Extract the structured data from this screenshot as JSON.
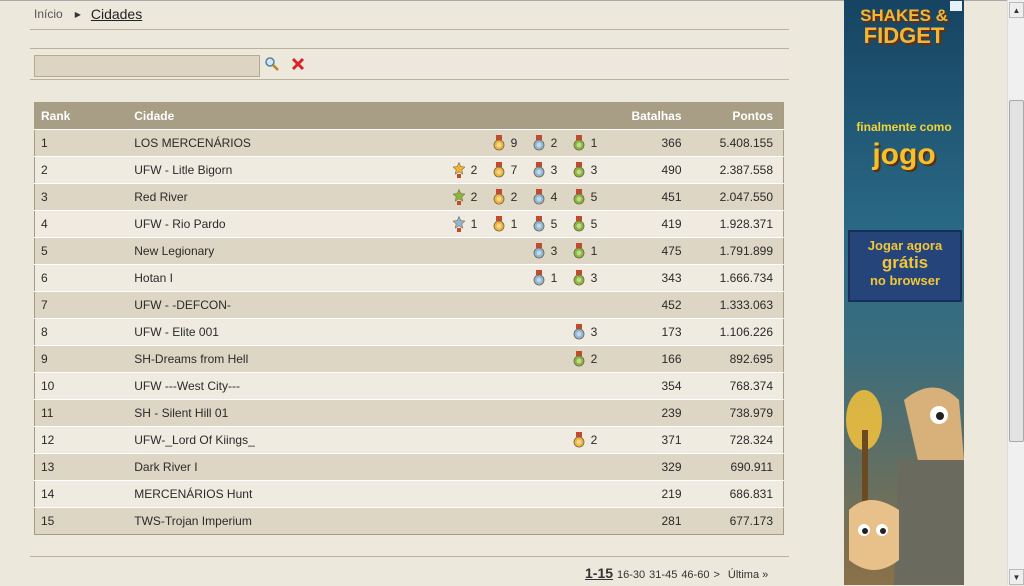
{
  "breadcrumb": {
    "home": "Início",
    "current": "Cidades"
  },
  "colors": {
    "gold": "#f0b53a",
    "silver": "#8fb6d8",
    "bronze": "#8ab83a",
    "gold_star": "#f2b431",
    "silver_star": "#8fb6d8",
    "bronze_star": "#8ab83a"
  },
  "table": {
    "headers": {
      "rank": "Rank",
      "city": "Cidade",
      "battles": "Batalhas",
      "points": "Pontos"
    },
    "rows": [
      {
        "rank": "1",
        "city": "LOS MERCENÁRIOS",
        "medals": [
          {
            "type": "gold",
            "count": "9"
          },
          {
            "type": "silver",
            "count": "2"
          },
          {
            "type": "bronze",
            "count": "1"
          }
        ],
        "battles": "366",
        "points": "5.408.155"
      },
      {
        "rank": "2",
        "city": "UFW - Litle Bigorn",
        "medals": [
          {
            "type": "gold_star",
            "count": "2"
          },
          {
            "type": "gold",
            "count": "7"
          },
          {
            "type": "silver",
            "count": "3"
          },
          {
            "type": "bronze",
            "count": "3"
          }
        ],
        "battles": "490",
        "points": "2.387.558"
      },
      {
        "rank": "3",
        "city": "Red River",
        "medals": [
          {
            "type": "bronze_star",
            "count": "2"
          },
          {
            "type": "gold",
            "count": "2"
          },
          {
            "type": "silver",
            "count": "4"
          },
          {
            "type": "bronze",
            "count": "5"
          }
        ],
        "battles": "451",
        "points": "2.047.550"
      },
      {
        "rank": "4",
        "city": "UFW - Rio Pardo",
        "medals": [
          {
            "type": "silver_star",
            "count": "1"
          },
          {
            "type": "gold",
            "count": "1"
          },
          {
            "type": "silver",
            "count": "5"
          },
          {
            "type": "bronze",
            "count": "5"
          }
        ],
        "battles": "419",
        "points": "1.928.371"
      },
      {
        "rank": "5",
        "city": "New Legionary",
        "medals": [
          {
            "type": "silver",
            "count": "3"
          },
          {
            "type": "bronze",
            "count": "1"
          }
        ],
        "battles": "475",
        "points": "1.791.899"
      },
      {
        "rank": "6",
        "city": "Hotan I",
        "medals": [
          {
            "type": "silver",
            "count": "1"
          },
          {
            "type": "bronze",
            "count": "3"
          }
        ],
        "battles": "343",
        "points": "1.666.734"
      },
      {
        "rank": "7",
        "city": "UFW - -DEFCON-",
        "medals": [],
        "battles": "452",
        "points": "1.333.063"
      },
      {
        "rank": "8",
        "city": "UFW - Elite 001",
        "medals": [
          {
            "type": "silver",
            "count": "3"
          }
        ],
        "battles": "173",
        "points": "1.106.226"
      },
      {
        "rank": "9",
        "city": "SH-Dreams from Hell",
        "medals": [
          {
            "type": "bronze",
            "count": "2"
          }
        ],
        "battles": "166",
        "points": "892.695"
      },
      {
        "rank": "10",
        "city": "UFW ---West City---",
        "medals": [],
        "battles": "354",
        "points": "768.374"
      },
      {
        "rank": "11",
        "city": "SH - Silent Hill 01",
        "medals": [],
        "battles": "239",
        "points": "738.979"
      },
      {
        "rank": "12",
        "city": "UFW-_Lord Of Kiings_",
        "medals": [
          {
            "type": "gold",
            "count": "2"
          }
        ],
        "battles": "371",
        "points": "728.324"
      },
      {
        "rank": "13",
        "city": "Dark River I",
        "medals": [],
        "battles": "329",
        "points": "690.911"
      },
      {
        "rank": "14",
        "city": "MERCENÁRIOS Hunt",
        "medals": [],
        "battles": "219",
        "points": "686.831"
      },
      {
        "rank": "15",
        "city": "TWS-Trojan Imperium",
        "medals": [],
        "battles": "281",
        "points": "677.173"
      }
    ]
  },
  "pagination": {
    "current": "1-15",
    "pages": [
      "16-30",
      "31-45",
      "46-60"
    ],
    "next": ">",
    "last": "Última »"
  },
  "ad": {
    "logo_line1": "SHAKES &",
    "logo_line2": "FIDGET",
    "slogan1": "finalmente como",
    "slogan2": "jogo",
    "cta1": "Jogar agora",
    "cta2": "grátis",
    "cta3": "no browser"
  }
}
